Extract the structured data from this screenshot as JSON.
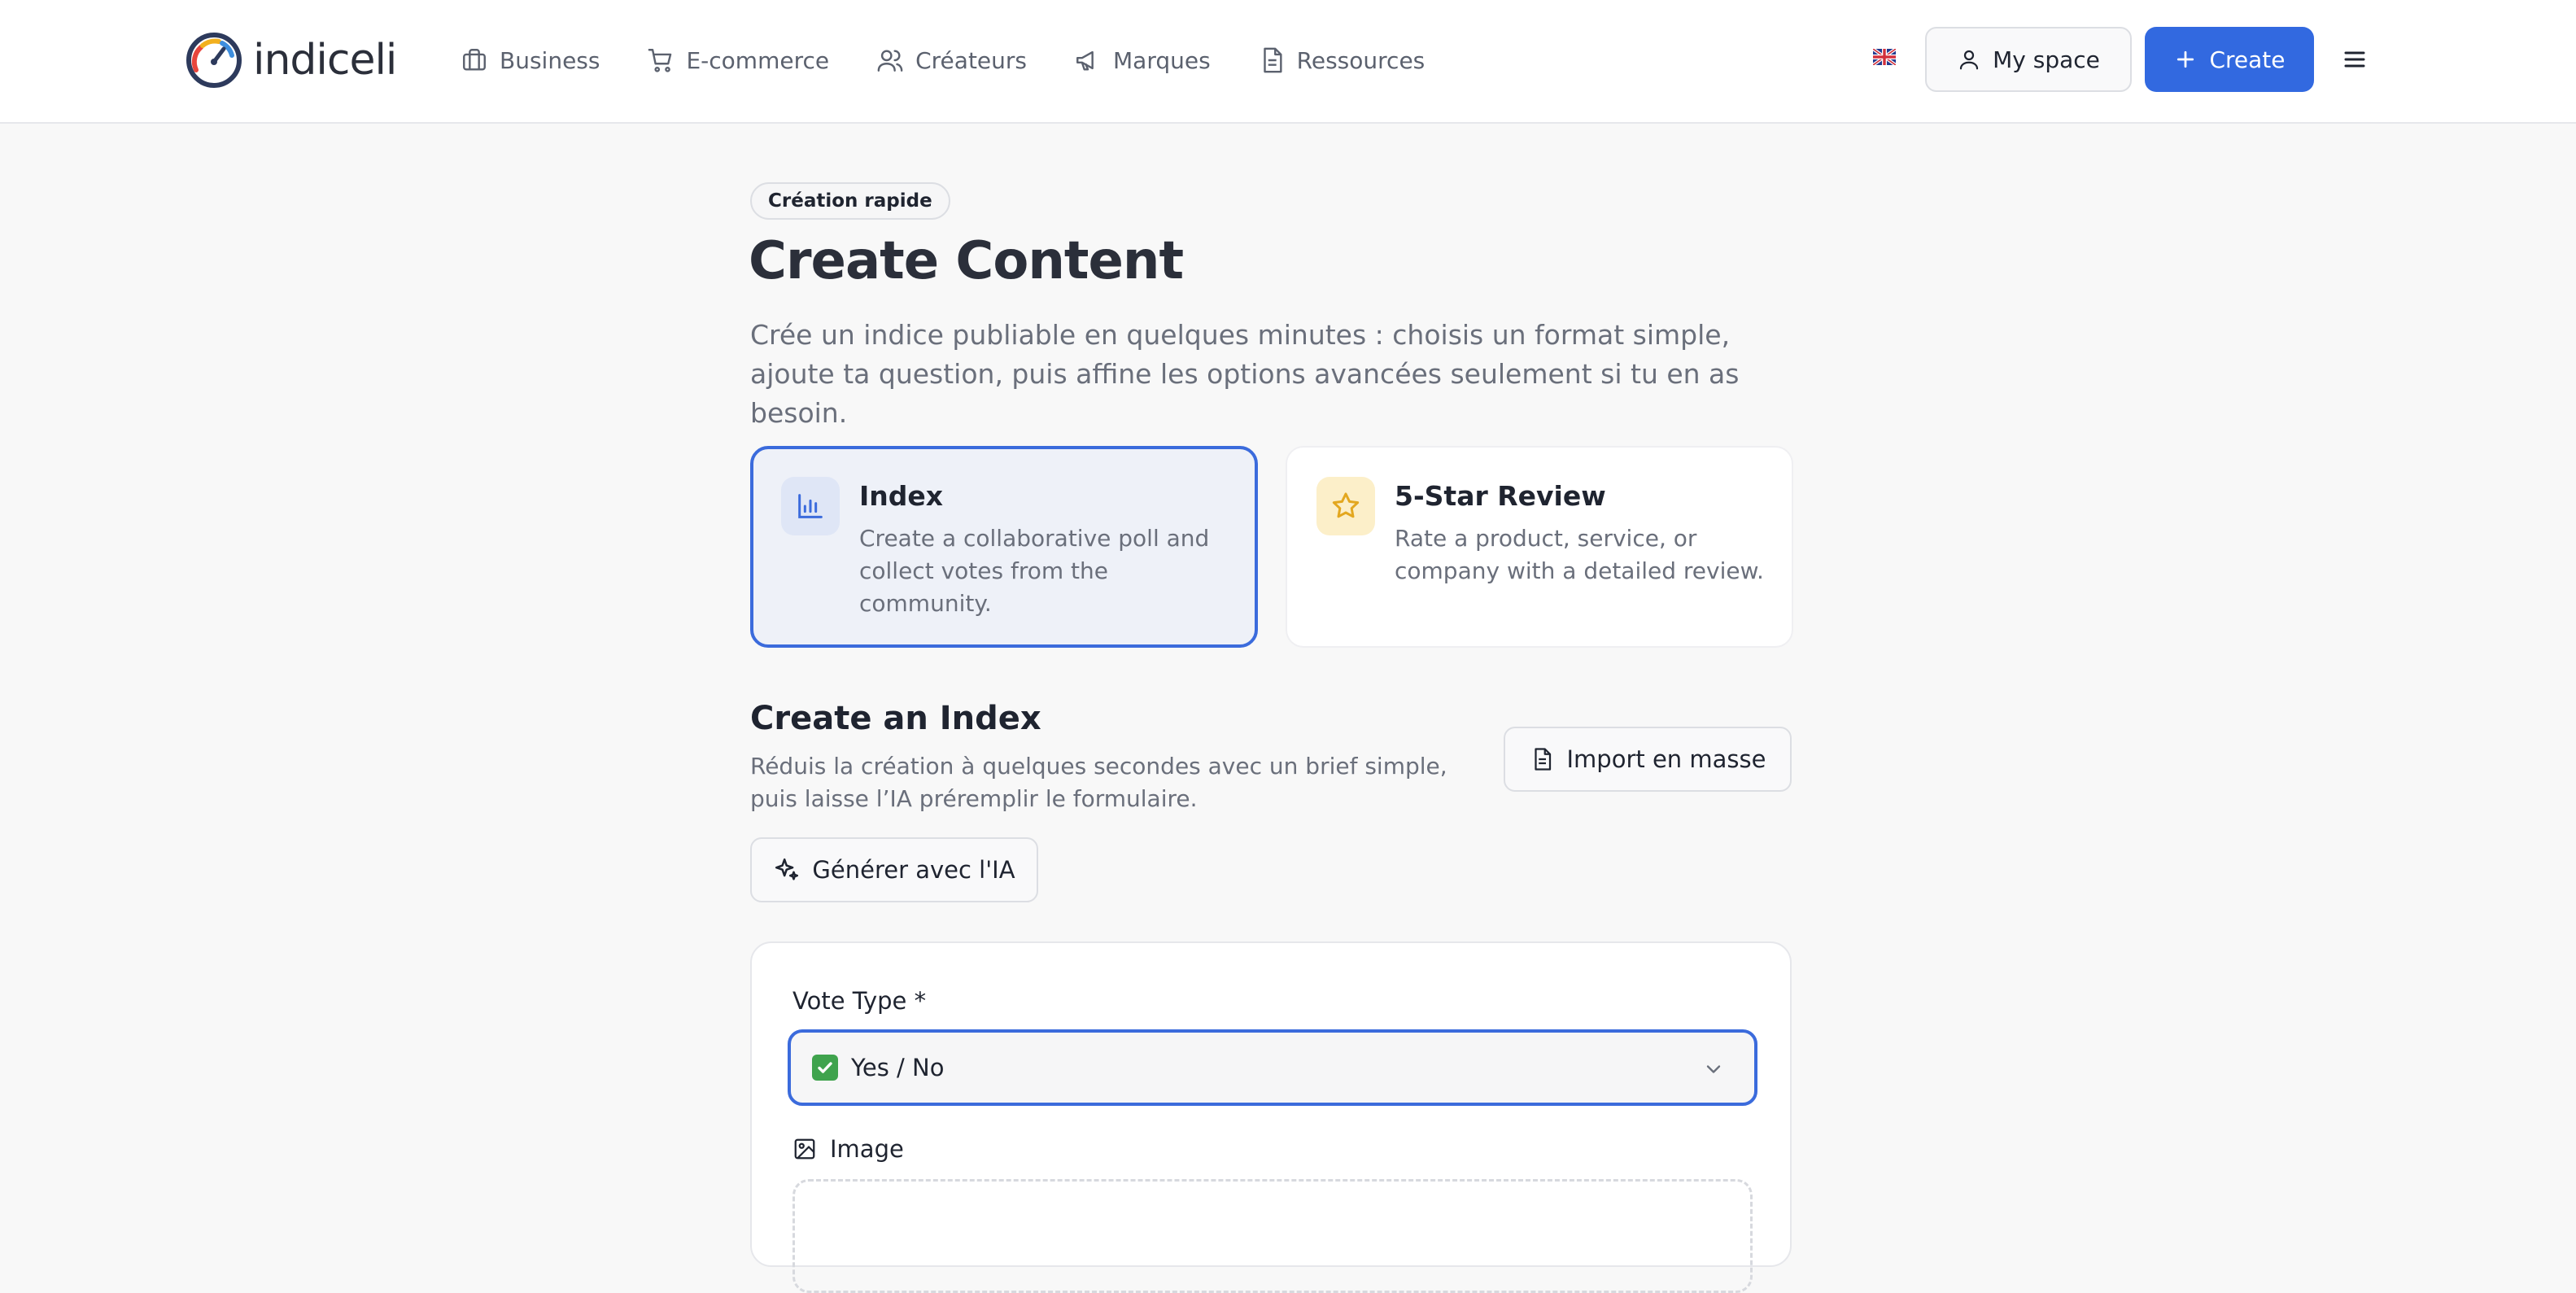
{
  "header": {
    "logo_text": "indiceli",
    "nav": [
      {
        "label": "Business",
        "icon": "briefcase-icon"
      },
      {
        "label": "E-commerce",
        "icon": "cart-icon"
      },
      {
        "label": "Créateurs",
        "icon": "users-icon"
      },
      {
        "label": "Marques",
        "icon": "megaphone-icon"
      },
      {
        "label": "Ressources",
        "icon": "document-icon"
      }
    ],
    "language_icon": "uk-flag-icon",
    "my_space_label": "My space",
    "create_label": "Create",
    "menu_icon": "hamburger-icon"
  },
  "page": {
    "badge": "Création rapide",
    "title": "Create Content",
    "description": "Crée un indice publiable en quelques minutes : choisis un format simple, ajoute ta question, puis affine les options avancées seulement si tu en as besoin."
  },
  "content_types": [
    {
      "title": "Index",
      "description": "Create a collaborative poll and collect votes from the community.",
      "icon": "bar-chart-icon",
      "selected": true
    },
    {
      "title": "5-Star Review",
      "description": "Rate a product, service, or company with a detailed review.",
      "icon": "star-icon",
      "selected": false
    }
  ],
  "section": {
    "title": "Create an Index",
    "description": "Réduis la création à quelques secondes avec un brief simple, puis laisse l’IA préremplir le formulaire.",
    "import_label": "Import en masse",
    "ai_label": "Générer avec l'IA"
  },
  "form": {
    "vote_type_label": "Vote Type *",
    "vote_type_value": "Yes / No",
    "image_label": "Image"
  },
  "colors": {
    "accent": "#3269e0",
    "selected_border": "#3b6bdc",
    "selected_bg": "#eef1f8",
    "star_bg": "#fcefc9",
    "star": "#e3a71f",
    "check": "#3fa34d"
  }
}
